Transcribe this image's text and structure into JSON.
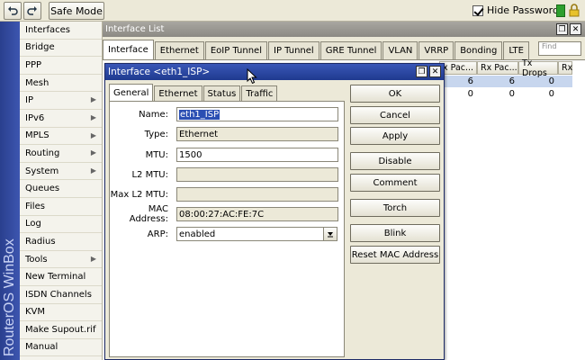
{
  "toolbar": {
    "undo_icon": "undo-icon",
    "redo_icon": "redo-icon",
    "safe_mode_label": "Safe Mode",
    "hide_passwords_label": "Hide Passwords",
    "hide_passwords_checked": true,
    "status_color": "#2e9f2e"
  },
  "banner": {
    "text": "RouterOS WinBox"
  },
  "sidebar": {
    "items": [
      {
        "label": "Interfaces",
        "submenu": false
      },
      {
        "label": "Bridge",
        "submenu": false
      },
      {
        "label": "PPP",
        "submenu": false
      },
      {
        "label": "Mesh",
        "submenu": false
      },
      {
        "label": "IP",
        "submenu": true
      },
      {
        "label": "IPv6",
        "submenu": true
      },
      {
        "label": "MPLS",
        "submenu": true
      },
      {
        "label": "Routing",
        "submenu": true
      },
      {
        "label": "System",
        "submenu": true
      },
      {
        "label": "Queues",
        "submenu": false
      },
      {
        "label": "Files",
        "submenu": false
      },
      {
        "label": "Log",
        "submenu": false
      },
      {
        "label": "Radius",
        "submenu": false
      },
      {
        "label": "Tools",
        "submenu": true
      },
      {
        "label": "New Terminal",
        "submenu": false
      },
      {
        "label": "ISDN Channels",
        "submenu": false
      },
      {
        "label": "KVM",
        "submenu": false
      },
      {
        "label": "Make Supout.rif",
        "submenu": false
      },
      {
        "label": "Manual",
        "submenu": false
      }
    ],
    "submenu_glyph": "▶"
  },
  "interface_list": {
    "title": "Interface List",
    "tabs": [
      "Interface",
      "Ethernet",
      "EoIP Tunnel",
      "IP Tunnel",
      "GRE Tunnel",
      "VLAN",
      "VRRP",
      "Bonding",
      "LTE"
    ],
    "find_placeholder": "Find",
    "columns": [
      "x Pac...",
      "Rx Pac...",
      "Tx Drops",
      "Rx"
    ],
    "rows": [
      [
        "6",
        "6",
        "0"
      ],
      [
        "0",
        "0",
        "0"
      ]
    ],
    "restore_glyph": "❐",
    "close_glyph": "✕"
  },
  "dialog": {
    "title": "Interface <eth1_ISP>",
    "tabs": [
      "General",
      "Ethernet",
      "Status",
      "Traffic"
    ],
    "fields": {
      "name_label": "Name:",
      "name_value": "eth1_ISP",
      "type_label": "Type:",
      "type_value": "Ethernet",
      "mtu_label": "MTU:",
      "mtu_value": "1500",
      "l2mtu_label": "L2 MTU:",
      "l2mtu_value": "",
      "maxl2mtu_label": "Max L2 MTU:",
      "maxl2mtu_value": "",
      "mac_label": "MAC Address:",
      "mac_value": "08:00:27:AC:FE:7C",
      "arp_label": "ARP:",
      "arp_value": "enabled"
    },
    "buttons": {
      "ok": "OK",
      "cancel": "Cancel",
      "apply": "Apply",
      "disable": "Disable",
      "comment": "Comment",
      "torch": "Torch",
      "blink": "Blink",
      "reset_mac": "Reset MAC Address"
    },
    "restore_glyph": "❐",
    "close_glyph": "✕"
  }
}
